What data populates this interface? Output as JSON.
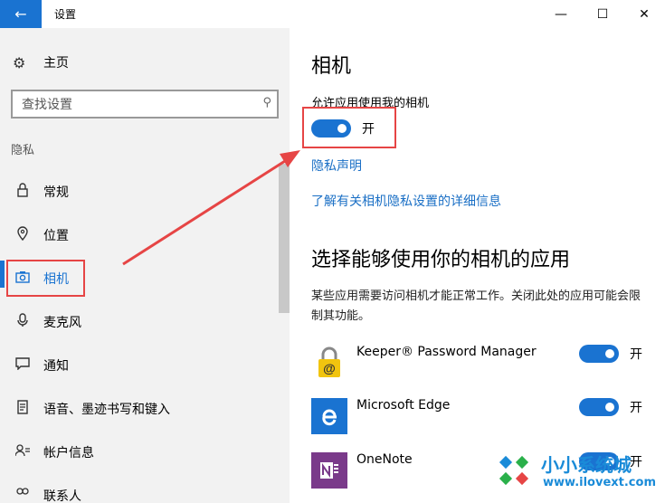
{
  "window": {
    "title": "设置",
    "back_icon": "←",
    "minimize_icon": "—",
    "maximize_icon": "☐",
    "close_icon": "✕"
  },
  "sidebar": {
    "home_label": "主页",
    "search_placeholder": "查找设置",
    "section_label": "隐私",
    "items": [
      {
        "label": "常规",
        "icon": "lock-icon"
      },
      {
        "label": "位置",
        "icon": "location-icon"
      },
      {
        "label": "相机",
        "icon": "camera-icon",
        "active": true
      },
      {
        "label": "麦克风",
        "icon": "microphone-icon"
      },
      {
        "label": "通知",
        "icon": "notification-icon"
      },
      {
        "label": "语音、墨迹书写和键入",
        "icon": "speech-icon"
      },
      {
        "label": "帐户信息",
        "icon": "account-icon"
      },
      {
        "label": "联系人",
        "icon": "contacts-icon"
      }
    ]
  },
  "main": {
    "title": "相机",
    "allow_label": "允许应用使用我的相机",
    "toggle_state": "开",
    "privacy_link": "隐私声明",
    "learn_more_link": "了解有关相机隐私设置的详细信息",
    "choose_title": "选择能够使用你的相机的应用",
    "description": "某些应用需要访问相机才能正常工作。关闭此处的应用可能会限制其功能。",
    "apps": [
      {
        "name": "Keeper® Password Manager",
        "state": "开",
        "icon": "keeper-lock-icon"
      },
      {
        "name": "Microsoft Edge",
        "state": "开",
        "icon": "edge-icon"
      },
      {
        "name": "OneNote",
        "state": "开",
        "icon": "onenote-icon"
      }
    ]
  },
  "watermark": {
    "cn": "小小系统城",
    "url": "www.ilovext.com"
  },
  "colors": {
    "accent": "#1a73d1",
    "annotation_red": "#e64545",
    "sidebar_bg": "#f2f2f2"
  }
}
